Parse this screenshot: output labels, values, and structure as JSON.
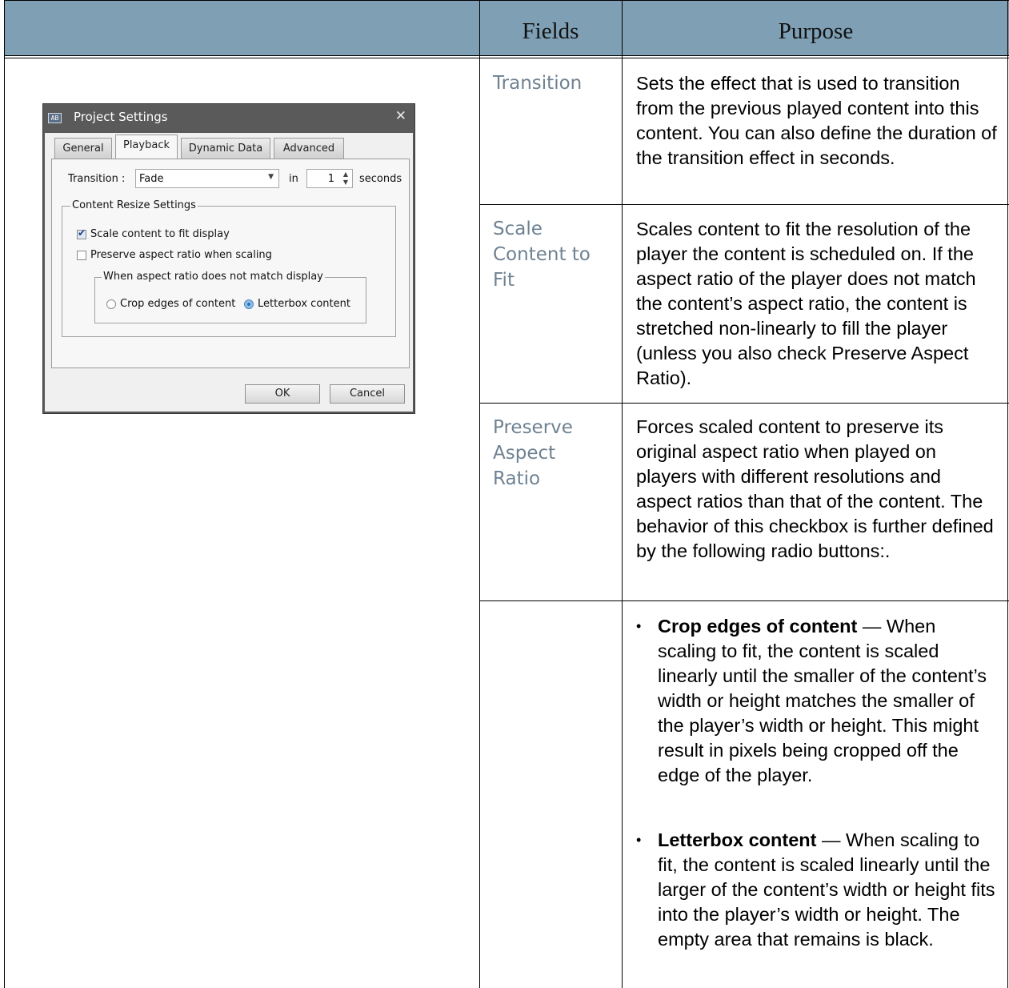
{
  "table": {
    "header": {
      "fields": "Fields",
      "purpose": "Purpose"
    },
    "rows": [
      {
        "field": "Transition",
        "purpose": "Sets the effect that is used to transition from the previous played content into this content. You can also define the duration of the transition effect in seconds."
      },
      {
        "field": "Scale Content to Fit",
        "purpose": "Scales content to fit the resolution of the player the content is scheduled on. If the aspect ratio of the player does not match the content’s aspect ratio, the content is stretched non-linearly to fill the player (unless you also check Preserve Aspect Ratio)."
      },
      {
        "field": "Preserve Aspect Ratio",
        "purpose": "Forces scaled content to preserve its original aspect ratio when played on players with different resolutions and aspect ratios than that of the content. The behavior of this checkbox is further defined by the following radio buttons:."
      }
    ],
    "bullets": [
      {
        "term": "Crop edges of content",
        "text": " — When scaling to fit, the content is scaled linearly until the smaller of the content’s width or height matches the smaller of the player’s width or height. This might result in pixels being cropped off the edge of the player."
      },
      {
        "term": "Letterbox content",
        "text": " — When scaling to fit, the content is scaled linearly until the larger of the content’s width or height fits into the player’s width or height. The empty area that remains is black."
      }
    ]
  },
  "dialog": {
    "title": "Project Settings",
    "icon_text": "AB",
    "close_glyph": "✕",
    "tabs": [
      "General",
      "Playback",
      "Dynamic Data",
      "Advanced"
    ],
    "active_tab": "Playback",
    "transition_label": "Transition :",
    "transition_value": "Fade",
    "in_label": "in",
    "duration_value": "1",
    "seconds_label": "seconds",
    "group_label": "Content Resize Settings",
    "scale_checkbox": {
      "label": "Scale content to fit display",
      "checked": true
    },
    "preserve_checkbox": {
      "label": "Preserve aspect ratio when scaling",
      "checked": false
    },
    "subgroup_label": "When aspect ratio does not match display",
    "radio_crop": {
      "label": "Crop edges of content",
      "selected": false
    },
    "radio_letterbox": {
      "label": "Letterbox content",
      "selected": true
    },
    "ok_label": "OK",
    "cancel_label": "Cancel"
  }
}
